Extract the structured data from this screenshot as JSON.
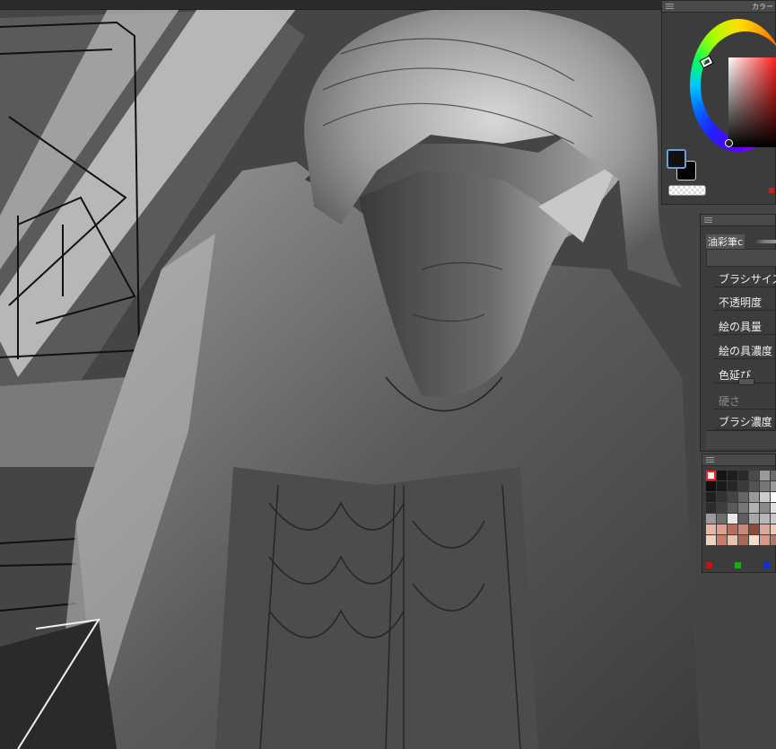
{
  "color_panel": {
    "title": "カラー",
    "foreground_color": "#111111",
    "background_color": "#050505"
  },
  "brush_panel": {
    "brush_name": "油彩筆c",
    "properties": [
      {
        "label": "ブラシサイズ",
        "enabled": true
      },
      {
        "label": "不透明度",
        "enabled": true
      },
      {
        "label": "絵の具量",
        "enabled": true
      },
      {
        "label": "絵の具濃度",
        "enabled": true
      },
      {
        "label": "色延び",
        "enabled": true
      },
      {
        "label": "硬さ",
        "enabled": false
      },
      {
        "label": "ブラシ濃度",
        "enabled": true
      }
    ]
  },
  "swatch_panel": {
    "rows": [
      [
        "#f2f2f2",
        "#151515",
        "#1e1e1e",
        "#2a2a2a",
        "#4a4a4a",
        "#9a9a9a",
        "#6a6a6a"
      ],
      [
        "#101010",
        "#1a1a1a",
        "#262626",
        "#3a3a3a",
        "#535353",
        "#777777",
        "#9a9a9a"
      ],
      [
        "#202020",
        "#333333",
        "#444444",
        "#666666",
        "#999999",
        "#cccccc",
        "#ffffff"
      ],
      [
        "#2c2c2c",
        "#3f3f3f",
        "#5a5a5a",
        "#777777",
        "#b2b2b2",
        "#8a8a8a",
        "#e0e0e0"
      ],
      [
        "#9a9a9a",
        "#6e6e6e",
        "#e8e8e8",
        "#5e5e5e",
        "#a8a8a8",
        "#b7b7b7",
        "#c8c8c8"
      ],
      [
        "#e6b8a8",
        "#dba090",
        "#b5705c",
        "#c88a78",
        "#8a4a3c",
        "#d8a898",
        "#eec8b8"
      ],
      [
        "#f0d0c0",
        "#c0806c",
        "#e8c0b0",
        "#a86858",
        "#f4dcd0",
        "#d89888",
        "#b07868"
      ]
    ],
    "rgb_markers": [
      "#cc1010",
      "#10b010",
      "#1030d0"
    ]
  }
}
